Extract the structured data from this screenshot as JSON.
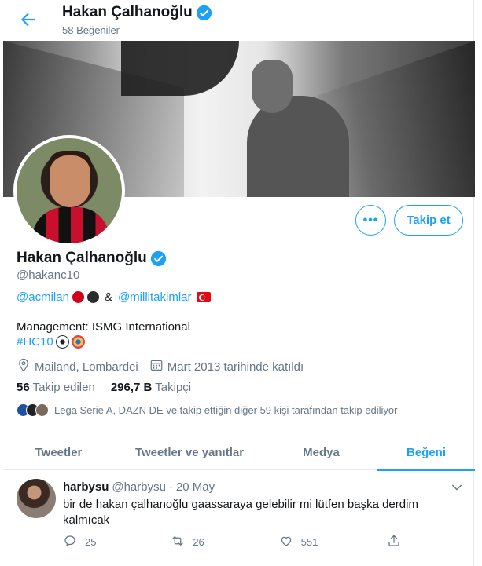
{
  "header": {
    "name": "Hakan Çalhanoğlu",
    "subtitle": "58 Beğeniler"
  },
  "profile": {
    "name": "Hakan Çalhanoğlu",
    "handle": "@hakanc10",
    "bio_line1": {
      "link1": "@acmilan",
      "amp": "&",
      "link2": "@millitakimlar"
    },
    "bio_line2": "Management: ISMG International",
    "bio_hashtag": "#HC10",
    "location": "Mailand, Lombardei",
    "joined": "Mart 2013 tarihinde katıldı",
    "following_count": "56",
    "following_label": "Takip edilen",
    "followers_count": "296,7 B",
    "followers_label": "Takipçi",
    "followed_by": "Lega Serie A, DAZN DE ve takip ettiğin diğer 59 kişi tarafından takip ediliyor"
  },
  "buttons": {
    "more": "•••",
    "follow": "Takip et"
  },
  "tabs": [
    {
      "label": "Tweetler"
    },
    {
      "label": "Tweetler ve yanıtlar"
    },
    {
      "label": "Medya"
    },
    {
      "label": "Beğeni"
    }
  ],
  "tweet": {
    "name": "harbysu",
    "handle": "@harbysu",
    "separator": "·",
    "date": "20 May",
    "text": "bir de hakan çalhanoğlu gaassaraya gelebilir mi lütfen başka derdim kalmıcak",
    "replies": "25",
    "retweets": "26",
    "likes": "551"
  },
  "colors": {
    "accent": "#1da1f2",
    "milan_red": "#d0021b",
    "milan_black": "#2b2b2b"
  }
}
